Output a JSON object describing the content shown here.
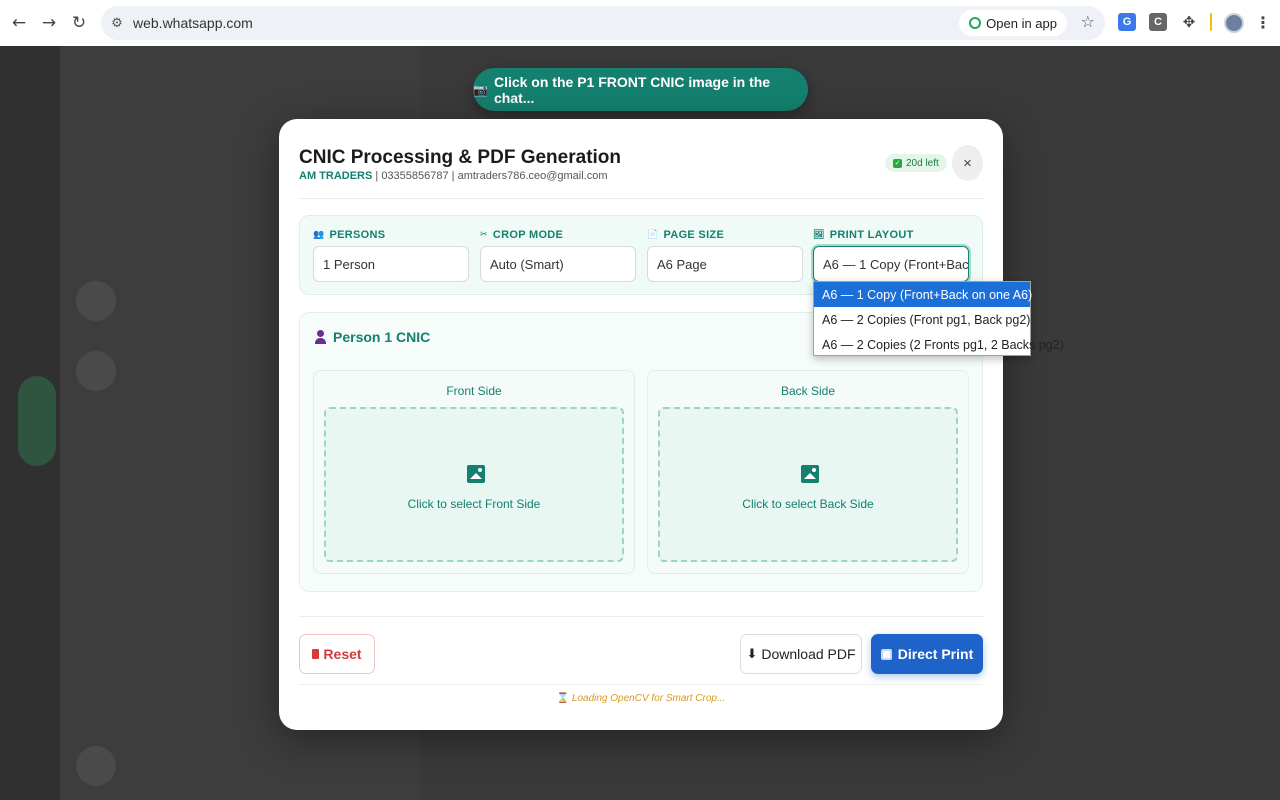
{
  "browser": {
    "url": "web.whatsapp.com",
    "open_in_app": "Open in app"
  },
  "toast": {
    "text": "Click on the P1 FRONT CNIC image in the chat..."
  },
  "modal": {
    "title": "CNIC Processing & PDF Generation",
    "brand": "AM TRADERS",
    "contact": " | 03355856787 | amtraders786.ceo@gmail.com",
    "days_left": "20d left",
    "close": "×",
    "settings": [
      {
        "label": "PERSONS",
        "icon": "people-icon",
        "value": "1 Person"
      },
      {
        "label": "CROP MODE",
        "icon": "scissors-icon",
        "value": "Auto (Smart)"
      },
      {
        "label": "PAGE SIZE",
        "icon": "page-icon",
        "value": "A6 Page"
      },
      {
        "label": "PRINT LAYOUT",
        "icon": "layout-icon",
        "value": "A6 — 1 Copy (Front+Back on one A6)"
      }
    ],
    "print_layout_options": [
      "A6 — 1 Copy (Front+Back on one A6)",
      "A6 — 2 Copies (Front pg1, Back pg2)",
      "A6 — 2 Copies (2 Fronts pg1, 2 Backs pg2)"
    ],
    "person": {
      "title": "Person 1 CNIC",
      "front": {
        "title": "Front Side",
        "hint": "Click to select Front Side"
      },
      "back": {
        "title": "Back Side",
        "hint": "Click to select Back Side"
      }
    },
    "buttons": {
      "reset": "Reset",
      "download": "Download PDF",
      "print": "Direct Print"
    },
    "loading": "Loading OpenCV for Smart Crop..."
  }
}
